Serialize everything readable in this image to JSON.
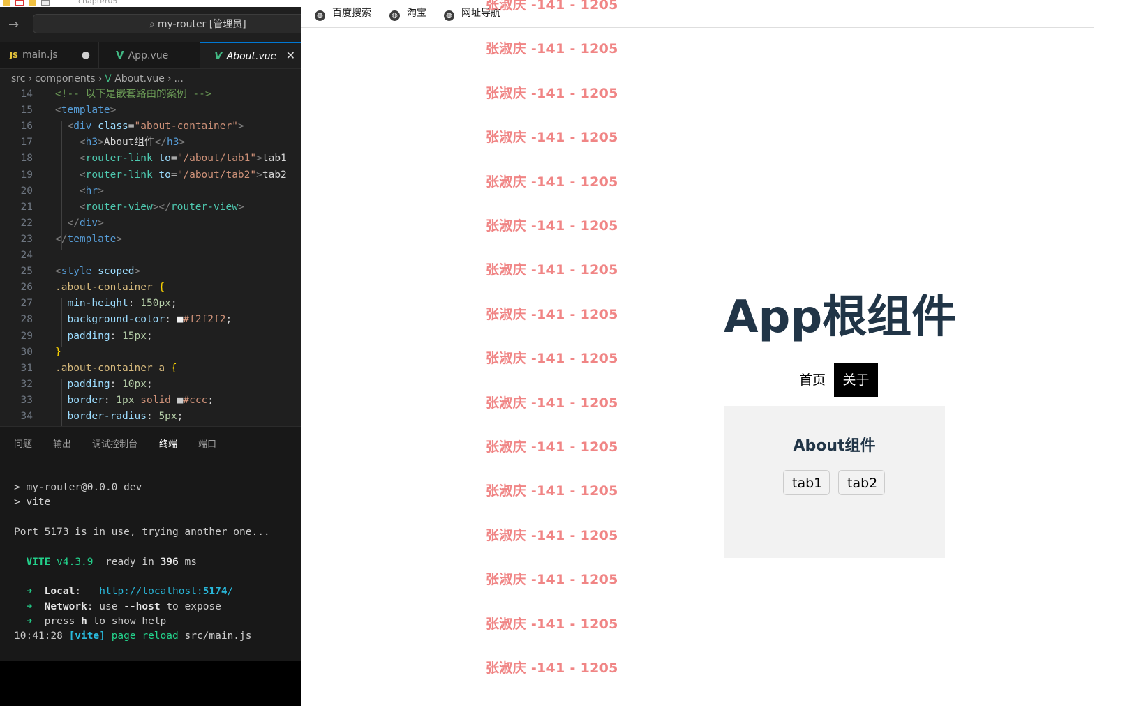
{
  "window": {
    "title": "chapter05"
  },
  "vscode": {
    "command_center": "my-router [管理员]",
    "tabs": [
      {
        "icon": "JS",
        "label": "main.js",
        "modified": "●"
      },
      {
        "icon": "V",
        "label": "App.vue"
      },
      {
        "icon": "V",
        "label": "About.vue",
        "close": "✕"
      }
    ],
    "breadcrumb": [
      "src",
      "components",
      "About.vue",
      "..."
    ],
    "code_lines": [
      {
        "n": "14",
        "segs": [
          [
            "<!-- 以下是嵌套路由的案例 -->",
            "#6a9955"
          ]
        ]
      },
      {
        "n": "15",
        "segs": [
          [
            "<",
            "#808080"
          ],
          [
            "template",
            "#569cd6"
          ],
          [
            ">",
            "#808080"
          ]
        ]
      },
      {
        "n": "16",
        "segs": [
          [
            "  ",
            "#d4d4d4"
          ],
          [
            "<",
            "#808080"
          ],
          [
            "div",
            "#569cd6"
          ],
          [
            " ",
            "#d4d4d4"
          ],
          [
            "class",
            "#9cdcfe"
          ],
          [
            "=",
            "#d4d4d4"
          ],
          [
            "\"about-container\"",
            "#ce9178"
          ],
          [
            ">",
            "#808080"
          ]
        ]
      },
      {
        "n": "17",
        "segs": [
          [
            "    ",
            "#d4d4d4"
          ],
          [
            "<",
            "#808080"
          ],
          [
            "h3",
            "#569cd6"
          ],
          [
            ">",
            "#808080"
          ],
          [
            "About组件",
            "#d4d4d4"
          ],
          [
            "</",
            "#808080"
          ],
          [
            "h3",
            "#569cd6"
          ],
          [
            ">",
            "#808080"
          ]
        ]
      },
      {
        "n": "18",
        "segs": [
          [
            "    ",
            "#d4d4d4"
          ],
          [
            "<",
            "#808080"
          ],
          [
            "router-link",
            "#4ec9b0"
          ],
          [
            " ",
            "#d4d4d4"
          ],
          [
            "to",
            "#9cdcfe"
          ],
          [
            "=",
            "#d4d4d4"
          ],
          [
            "\"/about/tab1\"",
            "#ce9178"
          ],
          [
            ">",
            "#808080"
          ],
          [
            "tab1",
            "#d4d4d4"
          ]
        ]
      },
      {
        "n": "19",
        "segs": [
          [
            "    ",
            "#d4d4d4"
          ],
          [
            "<",
            "#808080"
          ],
          [
            "router-link",
            "#4ec9b0"
          ],
          [
            " ",
            "#d4d4d4"
          ],
          [
            "to",
            "#9cdcfe"
          ],
          [
            "=",
            "#d4d4d4"
          ],
          [
            "\"/about/tab2\"",
            "#ce9178"
          ],
          [
            ">",
            "#808080"
          ],
          [
            "tab2",
            "#d4d4d4"
          ]
        ]
      },
      {
        "n": "20",
        "segs": [
          [
            "    ",
            "#d4d4d4"
          ],
          [
            "<",
            "#808080"
          ],
          [
            "hr",
            "#569cd6"
          ],
          [
            ">",
            "#808080"
          ]
        ]
      },
      {
        "n": "21",
        "segs": [
          [
            "    ",
            "#d4d4d4"
          ],
          [
            "<",
            "#808080"
          ],
          [
            "router-view",
            "#4ec9b0"
          ],
          [
            "></",
            "#808080"
          ],
          [
            "router-view",
            "#4ec9b0"
          ],
          [
            ">",
            "#808080"
          ]
        ]
      },
      {
        "n": "22",
        "segs": [
          [
            "  ",
            "#d4d4d4"
          ],
          [
            "</",
            "#808080"
          ],
          [
            "div",
            "#569cd6"
          ],
          [
            ">",
            "#808080"
          ]
        ]
      },
      {
        "n": "23",
        "segs": [
          [
            "</",
            "#808080"
          ],
          [
            "template",
            "#569cd6"
          ],
          [
            ">",
            "#808080"
          ]
        ]
      },
      {
        "n": "24",
        "segs": []
      },
      {
        "n": "25",
        "segs": [
          [
            "<",
            "#808080"
          ],
          [
            "style",
            "#569cd6"
          ],
          [
            " ",
            "#d4d4d4"
          ],
          [
            "scoped",
            "#9cdcfe"
          ],
          [
            ">",
            "#808080"
          ]
        ]
      },
      {
        "n": "26",
        "segs": [
          [
            ".about-container",
            "#d7ba7d"
          ],
          [
            " ",
            "#d4d4d4"
          ],
          [
            "{",
            "#ffd700"
          ]
        ]
      },
      {
        "n": "27",
        "segs": [
          [
            "  ",
            "#d4d4d4"
          ],
          [
            "min-height",
            "#9cdcfe"
          ],
          [
            ": ",
            "#d4d4d4"
          ],
          [
            "150px",
            "#b5cea8"
          ],
          [
            ";",
            "#d4d4d4"
          ]
        ]
      },
      {
        "n": "28",
        "segs": [
          [
            "  ",
            "#d4d4d4"
          ],
          [
            "background-color",
            "#9cdcfe"
          ],
          [
            ": ",
            "#d4d4d4"
          ],
          [
            "■",
            "#f2f2f2"
          ],
          [
            "#f2f2f2",
            "#ce9178"
          ],
          [
            ";",
            "#d4d4d4"
          ]
        ]
      },
      {
        "n": "29",
        "segs": [
          [
            "  ",
            "#d4d4d4"
          ],
          [
            "padding",
            "#9cdcfe"
          ],
          [
            ": ",
            "#d4d4d4"
          ],
          [
            "15px",
            "#b5cea8"
          ],
          [
            ";",
            "#d4d4d4"
          ]
        ]
      },
      {
        "n": "30",
        "segs": [
          [
            "}",
            "#ffd700"
          ]
        ]
      },
      {
        "n": "31",
        "segs": [
          [
            ".about-container a",
            "#d7ba7d"
          ],
          [
            " ",
            "#d4d4d4"
          ],
          [
            "{",
            "#ffd700"
          ]
        ]
      },
      {
        "n": "32",
        "segs": [
          [
            "  ",
            "#d4d4d4"
          ],
          [
            "padding",
            "#9cdcfe"
          ],
          [
            ": ",
            "#d4d4d4"
          ],
          [
            "10px",
            "#b5cea8"
          ],
          [
            ";",
            "#d4d4d4"
          ]
        ]
      },
      {
        "n": "33",
        "segs": [
          [
            "  ",
            "#d4d4d4"
          ],
          [
            "border",
            "#9cdcfe"
          ],
          [
            ": ",
            "#d4d4d4"
          ],
          [
            "1px",
            "#b5cea8"
          ],
          [
            " ",
            "#d4d4d4"
          ],
          [
            "solid",
            "#ce9178"
          ],
          [
            " ",
            "#d4d4d4"
          ],
          [
            "■",
            "#cccccc"
          ],
          [
            "#ccc",
            "#ce9178"
          ],
          [
            ";",
            "#d4d4d4"
          ]
        ]
      },
      {
        "n": "34",
        "segs": [
          [
            "  ",
            "#d4d4d4"
          ],
          [
            "border-radius",
            "#9cdcfe"
          ],
          [
            ": ",
            "#d4d4d4"
          ],
          [
            "5px",
            "#b5cea8"
          ],
          [
            ";",
            "#d4d4d4"
          ]
        ]
      }
    ],
    "panel_tabs": [
      "问题",
      "输出",
      "调试控制台",
      "终端",
      "端口"
    ],
    "terminal": {
      "line1": "> my-router@0.0.0 dev",
      "line2": "> vite",
      "line3": "Port 5173 is in use, trying another one...",
      "vite_name": "VITE",
      "vite_version": "v4.3.9",
      "ready_prefix": "ready in",
      "ready_ms": "396",
      "ready_unit": "ms",
      "arrow": "➜",
      "local_label": "Local",
      "local_url_base": "http://localhost:",
      "local_port": "5174",
      "local_url_end": "/",
      "network_label": "Network",
      "network_text1": "use",
      "network_flag": "--host",
      "network_text2": "to expose",
      "help_text1": "press",
      "help_key": "h",
      "help_text2": "to show help",
      "log_time": "10:41:28",
      "log_tag": "[vite]",
      "log_msg": "page reload",
      "log_file": "src/main.js"
    }
  },
  "browser": {
    "bookmarks": [
      "百度搜索",
      "淘宝",
      "网址导航"
    ],
    "watermark_text": "张淑庆 -141 - 1205",
    "app": {
      "title": "App根组件",
      "nav": [
        "首页",
        "关于"
      ],
      "about_title": "About组件",
      "about_tabs": [
        "tab1",
        "tab2"
      ]
    }
  }
}
